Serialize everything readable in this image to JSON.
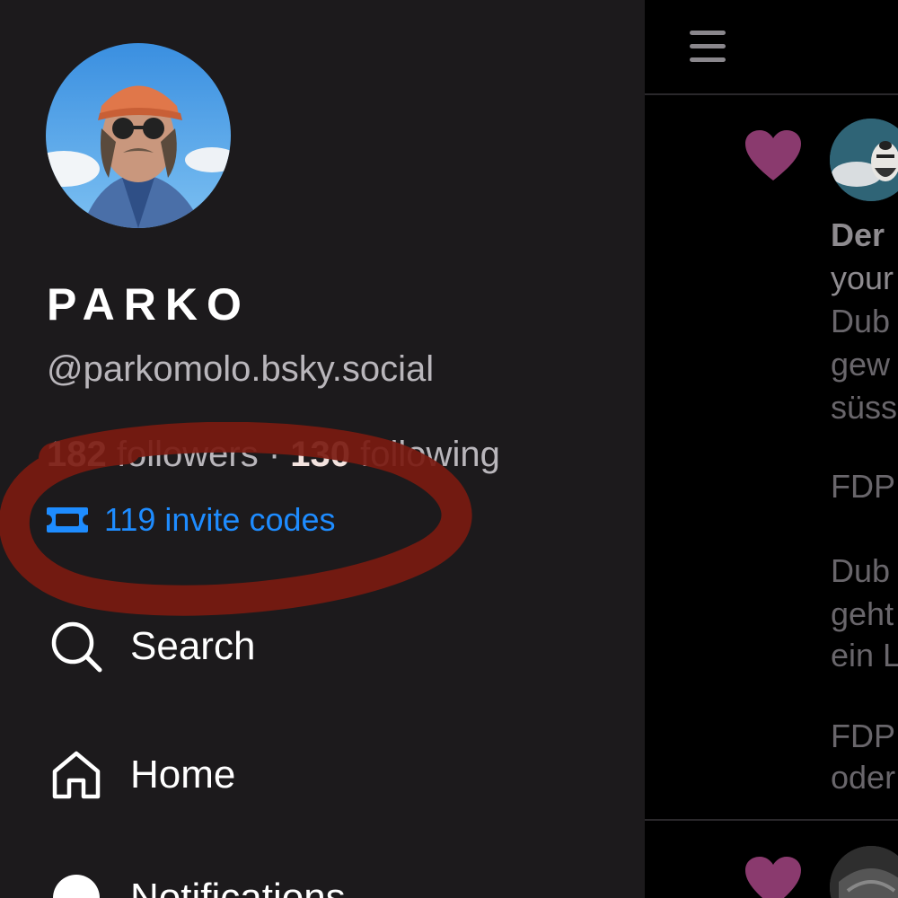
{
  "profile": {
    "display_name": "PARKO",
    "handle": "@parkomolo.bsky.social",
    "followers_count": "182",
    "followers_label": "followers",
    "separator": "·",
    "following_count": "130",
    "following_label": "following",
    "invite_codes": "119 invite codes",
    "avatar": "profile-photo-icon"
  },
  "nav": {
    "search": "Search",
    "home": "Home",
    "notifications": "Notifications"
  },
  "feed": {
    "post": {
      "author": "Der",
      "lines": [
        "your",
        "Dub",
        "gew",
        "süss",
        "FDP",
        "Dub",
        "geht",
        "ein L",
        "FDP",
        "oder"
      ]
    }
  },
  "colors": {
    "drawer_bg": "#1c1a1c",
    "feed_bg": "#000000",
    "invite_accent": "#1e8cff",
    "heart": "#8a3a6e",
    "scribble": "#7a1a10"
  },
  "icons": {
    "menu": "hamburger-icon",
    "like": "heart-icon",
    "invite": "ticket-icon",
    "search": "search-icon",
    "home": "home-icon",
    "notifications": "bell-icon"
  }
}
